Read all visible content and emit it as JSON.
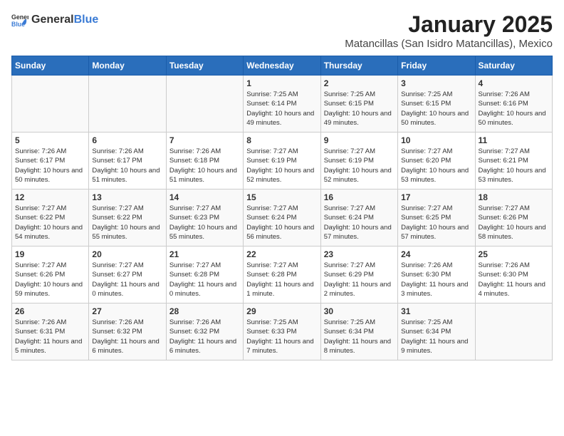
{
  "header": {
    "logo_general": "General",
    "logo_blue": "Blue",
    "title": "January 2025",
    "subtitle": "Matancillas (San Isidro Matancillas), Mexico"
  },
  "columns": [
    "Sunday",
    "Monday",
    "Tuesday",
    "Wednesday",
    "Thursday",
    "Friday",
    "Saturday"
  ],
  "weeks": [
    [
      {
        "day": "",
        "sunrise": "",
        "sunset": "",
        "daylight": ""
      },
      {
        "day": "",
        "sunrise": "",
        "sunset": "",
        "daylight": ""
      },
      {
        "day": "",
        "sunrise": "",
        "sunset": "",
        "daylight": ""
      },
      {
        "day": "1",
        "sunrise": "Sunrise: 7:25 AM",
        "sunset": "Sunset: 6:14 PM",
        "daylight": "Daylight: 10 hours and 49 minutes."
      },
      {
        "day": "2",
        "sunrise": "Sunrise: 7:25 AM",
        "sunset": "Sunset: 6:15 PM",
        "daylight": "Daylight: 10 hours and 49 minutes."
      },
      {
        "day": "3",
        "sunrise": "Sunrise: 7:25 AM",
        "sunset": "Sunset: 6:15 PM",
        "daylight": "Daylight: 10 hours and 50 minutes."
      },
      {
        "day": "4",
        "sunrise": "Sunrise: 7:26 AM",
        "sunset": "Sunset: 6:16 PM",
        "daylight": "Daylight: 10 hours and 50 minutes."
      }
    ],
    [
      {
        "day": "5",
        "sunrise": "Sunrise: 7:26 AM",
        "sunset": "Sunset: 6:17 PM",
        "daylight": "Daylight: 10 hours and 50 minutes."
      },
      {
        "day": "6",
        "sunrise": "Sunrise: 7:26 AM",
        "sunset": "Sunset: 6:17 PM",
        "daylight": "Daylight: 10 hours and 51 minutes."
      },
      {
        "day": "7",
        "sunrise": "Sunrise: 7:26 AM",
        "sunset": "Sunset: 6:18 PM",
        "daylight": "Daylight: 10 hours and 51 minutes."
      },
      {
        "day": "8",
        "sunrise": "Sunrise: 7:27 AM",
        "sunset": "Sunset: 6:19 PM",
        "daylight": "Daylight: 10 hours and 52 minutes."
      },
      {
        "day": "9",
        "sunrise": "Sunrise: 7:27 AM",
        "sunset": "Sunset: 6:19 PM",
        "daylight": "Daylight: 10 hours and 52 minutes."
      },
      {
        "day": "10",
        "sunrise": "Sunrise: 7:27 AM",
        "sunset": "Sunset: 6:20 PM",
        "daylight": "Daylight: 10 hours and 53 minutes."
      },
      {
        "day": "11",
        "sunrise": "Sunrise: 7:27 AM",
        "sunset": "Sunset: 6:21 PM",
        "daylight": "Daylight: 10 hours and 53 minutes."
      }
    ],
    [
      {
        "day": "12",
        "sunrise": "Sunrise: 7:27 AM",
        "sunset": "Sunset: 6:22 PM",
        "daylight": "Daylight: 10 hours and 54 minutes."
      },
      {
        "day": "13",
        "sunrise": "Sunrise: 7:27 AM",
        "sunset": "Sunset: 6:22 PM",
        "daylight": "Daylight: 10 hours and 55 minutes."
      },
      {
        "day": "14",
        "sunrise": "Sunrise: 7:27 AM",
        "sunset": "Sunset: 6:23 PM",
        "daylight": "Daylight: 10 hours and 55 minutes."
      },
      {
        "day": "15",
        "sunrise": "Sunrise: 7:27 AM",
        "sunset": "Sunset: 6:24 PM",
        "daylight": "Daylight: 10 hours and 56 minutes."
      },
      {
        "day": "16",
        "sunrise": "Sunrise: 7:27 AM",
        "sunset": "Sunset: 6:24 PM",
        "daylight": "Daylight: 10 hours and 57 minutes."
      },
      {
        "day": "17",
        "sunrise": "Sunrise: 7:27 AM",
        "sunset": "Sunset: 6:25 PM",
        "daylight": "Daylight: 10 hours and 57 minutes."
      },
      {
        "day": "18",
        "sunrise": "Sunrise: 7:27 AM",
        "sunset": "Sunset: 6:26 PM",
        "daylight": "Daylight: 10 hours and 58 minutes."
      }
    ],
    [
      {
        "day": "19",
        "sunrise": "Sunrise: 7:27 AM",
        "sunset": "Sunset: 6:26 PM",
        "daylight": "Daylight: 10 hours and 59 minutes."
      },
      {
        "day": "20",
        "sunrise": "Sunrise: 7:27 AM",
        "sunset": "Sunset: 6:27 PM",
        "daylight": "Daylight: 11 hours and 0 minutes."
      },
      {
        "day": "21",
        "sunrise": "Sunrise: 7:27 AM",
        "sunset": "Sunset: 6:28 PM",
        "daylight": "Daylight: 11 hours and 0 minutes."
      },
      {
        "day": "22",
        "sunrise": "Sunrise: 7:27 AM",
        "sunset": "Sunset: 6:28 PM",
        "daylight": "Daylight: 11 hours and 1 minute."
      },
      {
        "day": "23",
        "sunrise": "Sunrise: 7:27 AM",
        "sunset": "Sunset: 6:29 PM",
        "daylight": "Daylight: 11 hours and 2 minutes."
      },
      {
        "day": "24",
        "sunrise": "Sunrise: 7:26 AM",
        "sunset": "Sunset: 6:30 PM",
        "daylight": "Daylight: 11 hours and 3 minutes."
      },
      {
        "day": "25",
        "sunrise": "Sunrise: 7:26 AM",
        "sunset": "Sunset: 6:30 PM",
        "daylight": "Daylight: 11 hours and 4 minutes."
      }
    ],
    [
      {
        "day": "26",
        "sunrise": "Sunrise: 7:26 AM",
        "sunset": "Sunset: 6:31 PM",
        "daylight": "Daylight: 11 hours and 5 minutes."
      },
      {
        "day": "27",
        "sunrise": "Sunrise: 7:26 AM",
        "sunset": "Sunset: 6:32 PM",
        "daylight": "Daylight: 11 hours and 6 minutes."
      },
      {
        "day": "28",
        "sunrise": "Sunrise: 7:26 AM",
        "sunset": "Sunset: 6:32 PM",
        "daylight": "Daylight: 11 hours and 6 minutes."
      },
      {
        "day": "29",
        "sunrise": "Sunrise: 7:25 AM",
        "sunset": "Sunset: 6:33 PM",
        "daylight": "Daylight: 11 hours and 7 minutes."
      },
      {
        "day": "30",
        "sunrise": "Sunrise: 7:25 AM",
        "sunset": "Sunset: 6:34 PM",
        "daylight": "Daylight: 11 hours and 8 minutes."
      },
      {
        "day": "31",
        "sunrise": "Sunrise: 7:25 AM",
        "sunset": "Sunset: 6:34 PM",
        "daylight": "Daylight: 11 hours and 9 minutes."
      },
      {
        "day": "",
        "sunrise": "",
        "sunset": "",
        "daylight": ""
      }
    ]
  ]
}
